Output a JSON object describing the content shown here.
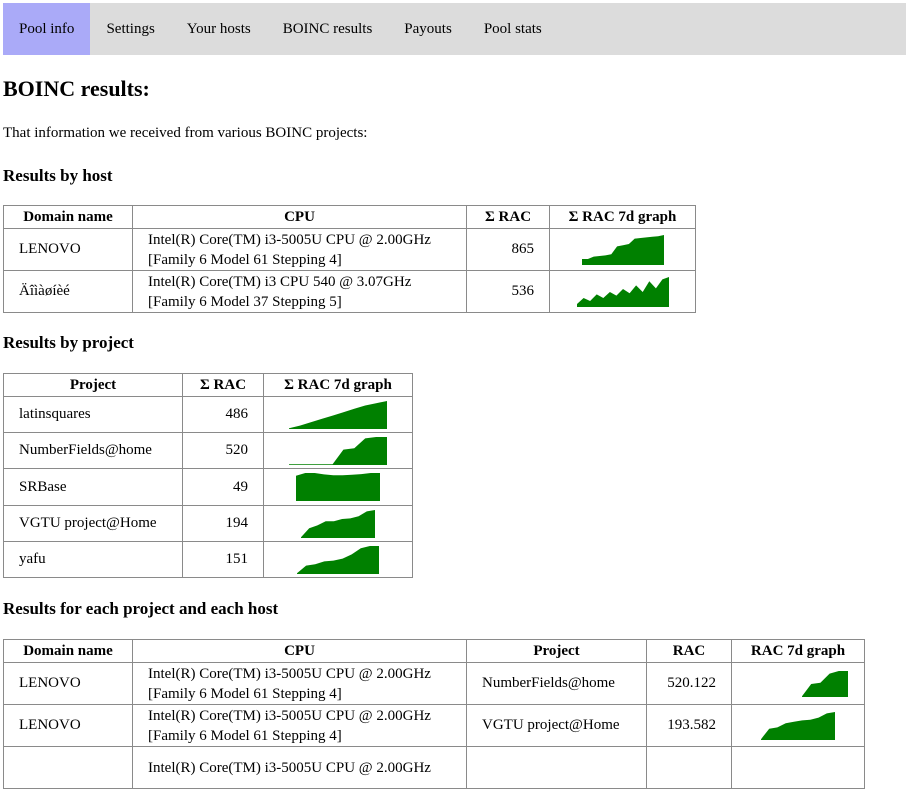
{
  "nav": {
    "tabs": [
      {
        "label": "Pool info",
        "active": true
      },
      {
        "label": "Settings",
        "active": false
      },
      {
        "label": "Your hosts",
        "active": false
      },
      {
        "label": "BOINC results",
        "active": false
      },
      {
        "label": "Payouts",
        "active": false
      },
      {
        "label": "Pool stats",
        "active": false
      }
    ]
  },
  "page": {
    "title": "BOINC results:",
    "intro": "That information we received from various BOINC projects:"
  },
  "by_host": {
    "heading": "Results by host",
    "headers": [
      "Domain name",
      "CPU",
      "Σ RAC",
      "Σ RAC 7d graph"
    ],
    "rows": [
      {
        "domain": "LENOVO",
        "cpu_line1": "Intel(R) Core(TM) i3-5005U CPU @ 2.00GHz",
        "cpu_line2": "[Family 6 Model 61 Stepping 4]",
        "rac": "865",
        "graph": [
          0.2,
          0.2,
          0.28,
          0.3,
          0.32,
          0.36,
          0.62,
          0.66,
          0.7,
          0.88,
          0.9,
          0.92,
          0.94,
          0.96,
          1
        ]
      },
      {
        "domain": "Äîìàøíèé",
        "cpu_line1": "Intel(R) Core(TM) i3 CPU 540 @ 3.07GHz",
        "cpu_line2": "[Family 6 Model 37 Stepping 5]",
        "rac": "536",
        "graph": [
          0.1,
          0.3,
          0.2,
          0.42,
          0.3,
          0.5,
          0.38,
          0.6,
          0.46,
          0.72,
          0.5,
          0.86,
          0.62,
          0.92,
          1
        ]
      }
    ]
  },
  "by_project": {
    "heading": "Results by project",
    "headers": [
      "Project",
      "Σ RAC",
      "Σ RAC 7d graph"
    ],
    "rows": [
      {
        "project": "latinsquares",
        "rac": "486",
        "graph": [
          0,
          0.12,
          0.24,
          0.36,
          0.48,
          0.6,
          0.72,
          0.84,
          0.92,
          1
        ]
      },
      {
        "project": "NumberFields@home",
        "rac": "520",
        "graph": [
          0,
          0,
          0,
          0,
          0,
          0.55,
          0.6,
          0.95,
          1,
          1
        ]
      },
      {
        "project": "SRBase",
        "rac": "49",
        "graph": [
          0.9,
          1,
          1,
          0.95,
          0.92,
          0.92,
          0.94,
          0.96,
          1,
          1
        ]
      },
      {
        "project": "VGTU project@Home",
        "rac": "194",
        "graph": [
          0,
          0.35,
          0.45,
          0.6,
          0.6,
          0.68,
          0.7,
          0.78,
          0.95,
          1
        ]
      },
      {
        "project": "yafu",
        "rac": "151",
        "graph": [
          0,
          0.3,
          0.35,
          0.45,
          0.48,
          0.55,
          0.7,
          0.92,
          1,
          1
        ]
      }
    ]
  },
  "by_project_host": {
    "heading": "Results for each project and each host",
    "headers": [
      "Domain name",
      "CPU",
      "Project",
      "RAC",
      "RAC 7d graph"
    ],
    "rows": [
      {
        "domain": "LENOVO",
        "cpu_line1": "Intel(R) Core(TM) i3-5005U CPU @ 2.00GHz",
        "cpu_line2": "[Family 6 Model 61 Stepping 4]",
        "project": "NumberFields@home",
        "rac": "520.122",
        "graph": [
          0,
          0.5,
          0.55,
          0.9,
          1,
          1
        ]
      },
      {
        "domain": "LENOVO",
        "cpu_line1": "Intel(R) Core(TM) i3-5005U CPU @ 2.00GHz",
        "cpu_line2": "[Family 6 Model 61 Stepping 4]",
        "project": "VGTU project@Home",
        "rac": "193.582",
        "graph": [
          0,
          0.4,
          0.45,
          0.6,
          0.65,
          0.7,
          0.72,
          0.8,
          0.95,
          1
        ]
      },
      {
        "domain": "",
        "cpu_line1": "Intel(R) Core(TM) i3-5005U CPU @ 2.00GHz",
        "cpu_line2": "",
        "project": "",
        "rac": "",
        "graph": []
      }
    ]
  },
  "colors": {
    "graph_fill": "#008000",
    "active_tab": "#aaaaf8",
    "nav_bg": "#dcdcdc"
  }
}
